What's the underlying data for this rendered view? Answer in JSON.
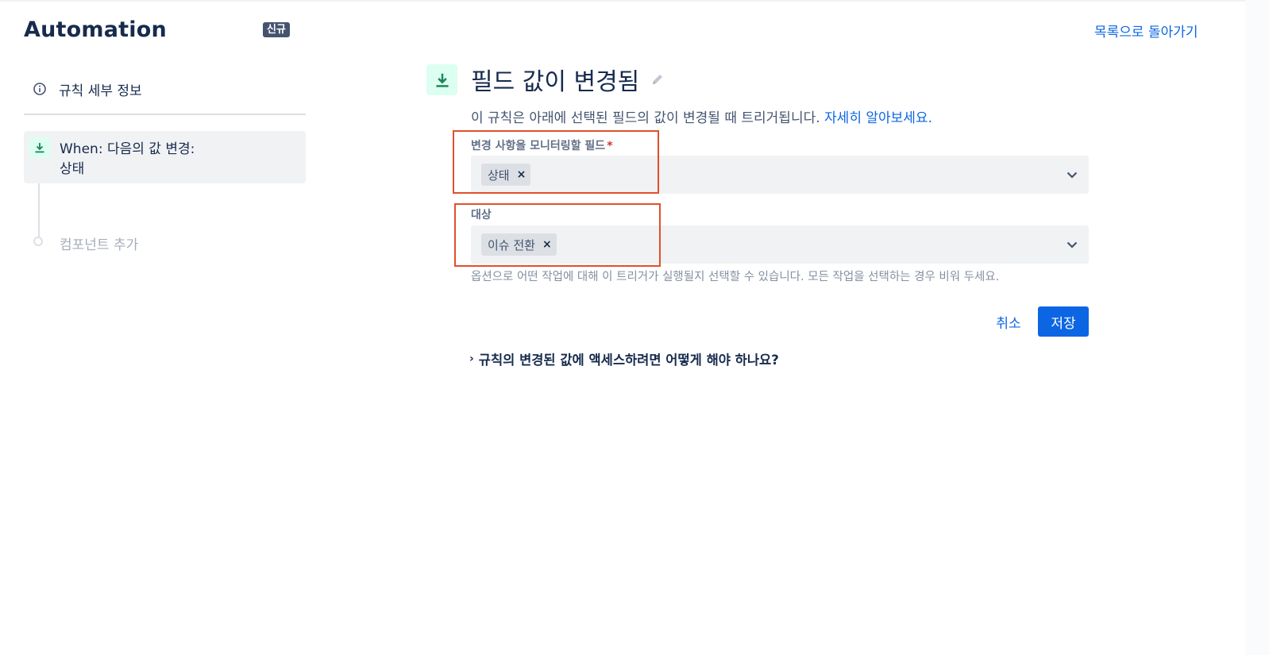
{
  "header": {
    "app_title": "Automation",
    "badge": "신규",
    "back_link": "목록으로 돌아가기"
  },
  "sidebar": {
    "rule_details": "규칙 세부 정보",
    "trigger_line1": "When: 다음의 값 변경:",
    "trigger_line2": "상태",
    "add_component": "컴포넌트 추가"
  },
  "main": {
    "title": "필드 값이 변경됨",
    "description": "이 규칙은 아래에 선택된 필드의 값이 변경될 때 트리거됩니다.",
    "learn_more": "자세히 알아보세요."
  },
  "fields": {
    "monitor": {
      "label": "변경 사항을 모니터링할 필드",
      "required_mark": "*",
      "chip": "상태",
      "remove": "×"
    },
    "target": {
      "label": "대상",
      "chip": "이슈 전환",
      "remove": "×",
      "hint": "옵션으로 어떤 작업에 대해 이 트리거가 실행될지 선택할 수 있습니다. 모든 작업을 선택하는 경우 비워 두세요."
    }
  },
  "actions": {
    "cancel": "취소",
    "save": "저장"
  },
  "faq": {
    "question": "규칙의 변경된 값에 액세스하려면 어떻게 해야 하나요?"
  },
  "colors": {
    "primary": "#0c66e4",
    "highlight_border": "#e0502b",
    "trigger_icon_bg": "#dcfff1",
    "trigger_icon_fg": "#1f845a"
  },
  "icons": [
    "info-icon",
    "download-trigger-icon",
    "pencil-icon",
    "chevron-down-icon",
    "chevron-right-icon",
    "close-icon"
  ]
}
